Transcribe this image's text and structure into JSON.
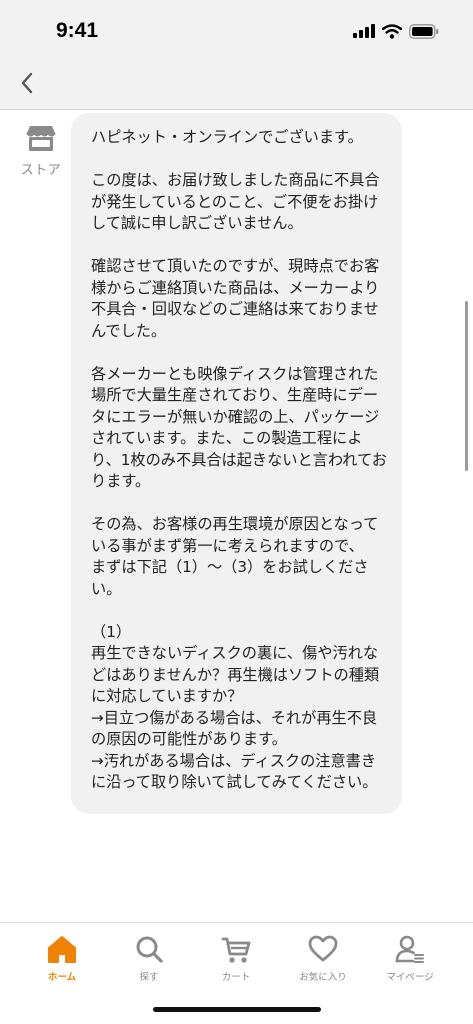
{
  "status_bar": {
    "time": "9:41"
  },
  "store": {
    "label": "ストア"
  },
  "message": {
    "paragraphs": [
      "ハピネット・オンラインでございます。",
      "この度は、お届け致しました商品に不具合が発生しているとのこと、ご不便をお掛けして誠に申し訳ございません。",
      "確認させて頂いたのですが、現時点でお客様からご連絡頂いた商品は、メーカーより不具合・回収などのご連絡は来ておりませんでした。",
      "各メーカーとも映像ディスクは管理された場所で大量生産されており、生産時にデータにエラーが無いか確認の上、パッケージされています。また、この製造工程により、1枚のみ不具合は起きないと言われております。",
      "その為、お客様の再生環境が原因となっている事がまず第一に考えられますので、\nまずは下記（1）～（3）をお試しください。",
      "（1）\n再生できないディスクの裏に、傷や汚れなどはありませんか？再生機はソフトの種類に対応していますか？\n→目立つ傷がある場合は、それが再生不良の原因の可能性があります。\n→汚れがある場合は、ディスクの注意書きに沿って取り除いて試してみてください。"
    ]
  },
  "tabs": [
    {
      "label": "ホーム",
      "icon": "home-icon",
      "active": true
    },
    {
      "label": "探す",
      "icon": "search-icon",
      "active": false
    },
    {
      "label": "カート",
      "icon": "cart-icon",
      "active": false
    },
    {
      "label": "お気に入り",
      "icon": "heart-icon",
      "active": false
    },
    {
      "label": "マイページ",
      "icon": "user-icon",
      "active": false
    }
  ],
  "colors": {
    "accent": "#f08300",
    "icon_gray": "#8a8a8a",
    "bubble": "#f1f1f1"
  }
}
